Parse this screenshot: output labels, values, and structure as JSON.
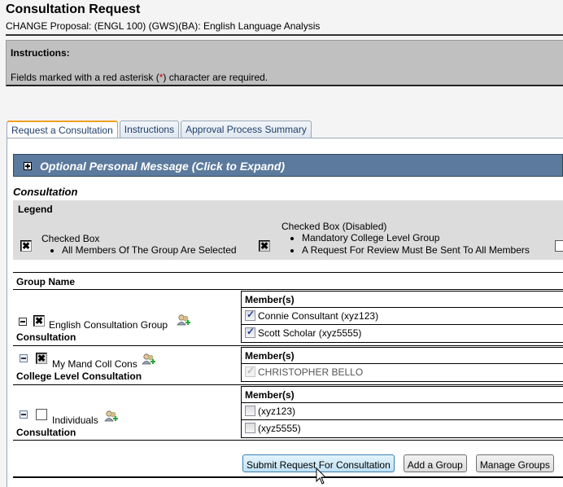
{
  "page": {
    "title": "Consultation Request",
    "subtitle": "CHANGE Proposal: (ENGL 100) (GWS)(BA): English Language Analysis"
  },
  "instructions": {
    "heading": "Instructions:",
    "text_before": "Fields marked with a red asterisk (",
    "asterisk": "*",
    "text_after": ") character are required."
  },
  "tabs": [
    {
      "label": "Request a Consultation",
      "active": true
    },
    {
      "label": "Instructions",
      "active": false
    },
    {
      "label": "Approval Process Summary",
      "active": false
    }
  ],
  "personal_message": {
    "label": "Optional Personal Message (Click to Expand)",
    "icon": "plus-icon"
  },
  "section_title": "Consultation",
  "legend": {
    "heading": "Legend",
    "items": [
      {
        "title": "Checked Box",
        "bullets": [
          "All Members Of The Group Are Selected"
        ],
        "icon": "x-checkbox-icon"
      },
      {
        "title": "Checked Box (Disabled)",
        "bullets": [
          "Mandatory College Level Group",
          "A Request For Review Must Be Sent To All Members"
        ],
        "icon": "x-checkbox-disabled-icon"
      }
    ]
  },
  "groups_table": {
    "header": "Group Name",
    "members_header": "Member(s)",
    "groups": [
      {
        "name": "English Consultation Group",
        "type": "Consultation",
        "checked": true,
        "members": [
          {
            "label": "Connie Consultant (xyz123)",
            "checked": true,
            "disabled": false
          },
          {
            "label": "Scott Scholar (xyz5555)",
            "checked": true,
            "disabled": false
          }
        ]
      },
      {
        "name": "My Mand Coll Cons",
        "type": "College Level Consultation",
        "checked": true,
        "members": [
          {
            "label": "CHRISTOPHER BELLO",
            "checked": true,
            "disabled": true
          }
        ]
      },
      {
        "name": "Individuals",
        "type": "Consultation",
        "checked": false,
        "members": [
          {
            "label": "(xyz123)",
            "checked": false,
            "disabled": false
          },
          {
            "label": "(xyz5555)",
            "checked": false,
            "disabled": false
          }
        ]
      }
    ]
  },
  "buttons": {
    "submit": "Submit Request For Consultation",
    "add_group": "Add a Group",
    "manage_groups": "Manage Groups"
  },
  "colors": {
    "panel_bar": "#5b7a9d",
    "instructions_bg": "#c0c0c0",
    "legend_bg": "#dcdcdc",
    "required_red": "#cc0000",
    "tab_active_accent": "#f0a020"
  }
}
